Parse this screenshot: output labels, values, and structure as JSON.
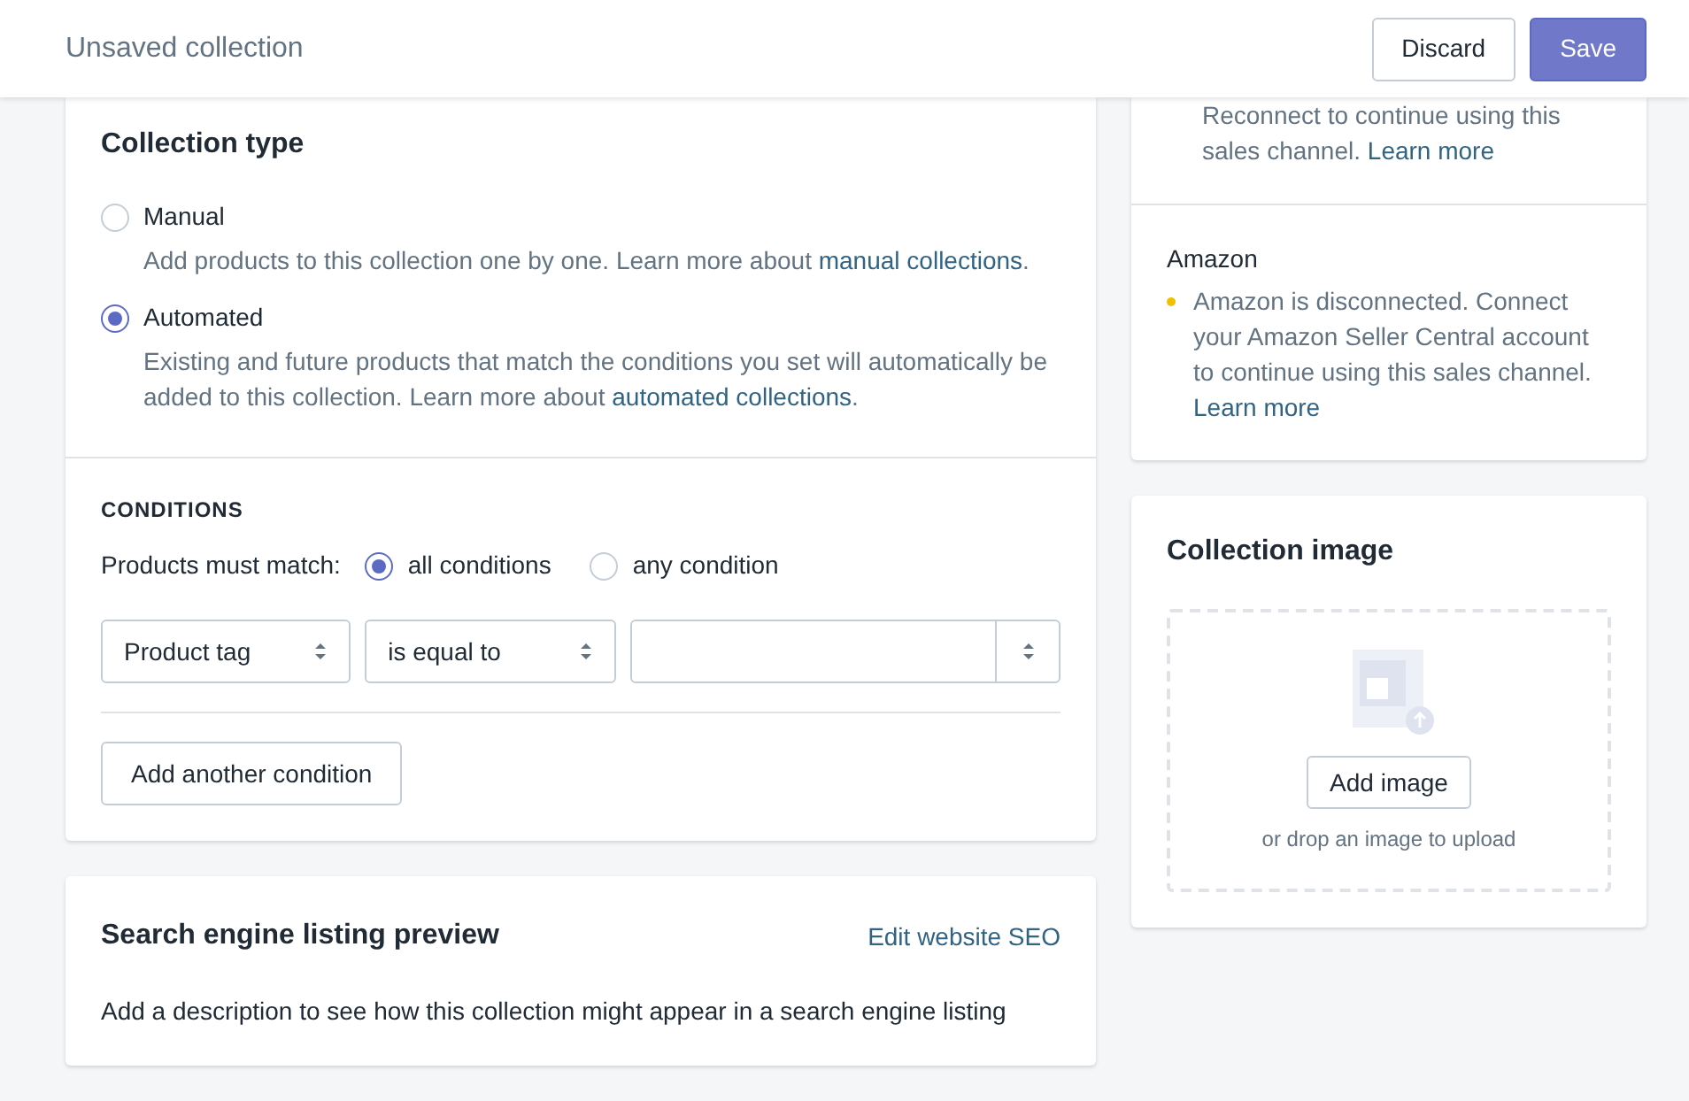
{
  "header": {
    "title": "Unsaved collection",
    "buttons": [
      {
        "label": "Discard",
        "kind": "secondary"
      },
      {
        "label": "Save",
        "kind": "primary"
      }
    ]
  },
  "collection_type": {
    "title": "Collection type",
    "options": [
      {
        "label": "Manual",
        "selected": false,
        "description": "Add products to this collection one by one. Learn more about ",
        "link": "manual collections",
        "after": "."
      },
      {
        "label": "Automated",
        "selected": true,
        "description": "Existing and future products that match the conditions you set will automatically be added to this collection. Learn more about ",
        "link": "automated collections",
        "after": "."
      }
    ]
  },
  "conditions": {
    "title": "CONDITIONS",
    "match_label": "Products must match:",
    "match_options": [
      {
        "label": "all conditions",
        "selected": true
      },
      {
        "label": "any condition",
        "selected": false
      }
    ],
    "rows": [
      {
        "field": "Product tag",
        "operator": "is equal to"
      }
    ],
    "add_button": "Add another condition"
  },
  "seo": {
    "title": "Search engine listing preview",
    "link": "Edit website SEO",
    "description": "Add a description to see how this collection might appear in a search engine listing"
  },
  "sales_channels": [
    {
      "message": "Reconnect to continue using this sales channel. ",
      "link": "Learn more"
    },
    {
      "name": "Amazon",
      "message": "Amazon is disconnected. Connect your Amazon Seller Central account to continue using this sales channel. ",
      "link": "Learn more",
      "color": "#eec200"
    }
  ],
  "collection_image": {
    "title": "Collection image",
    "button": "Add image",
    "hint": "or drop an image to upload"
  }
}
